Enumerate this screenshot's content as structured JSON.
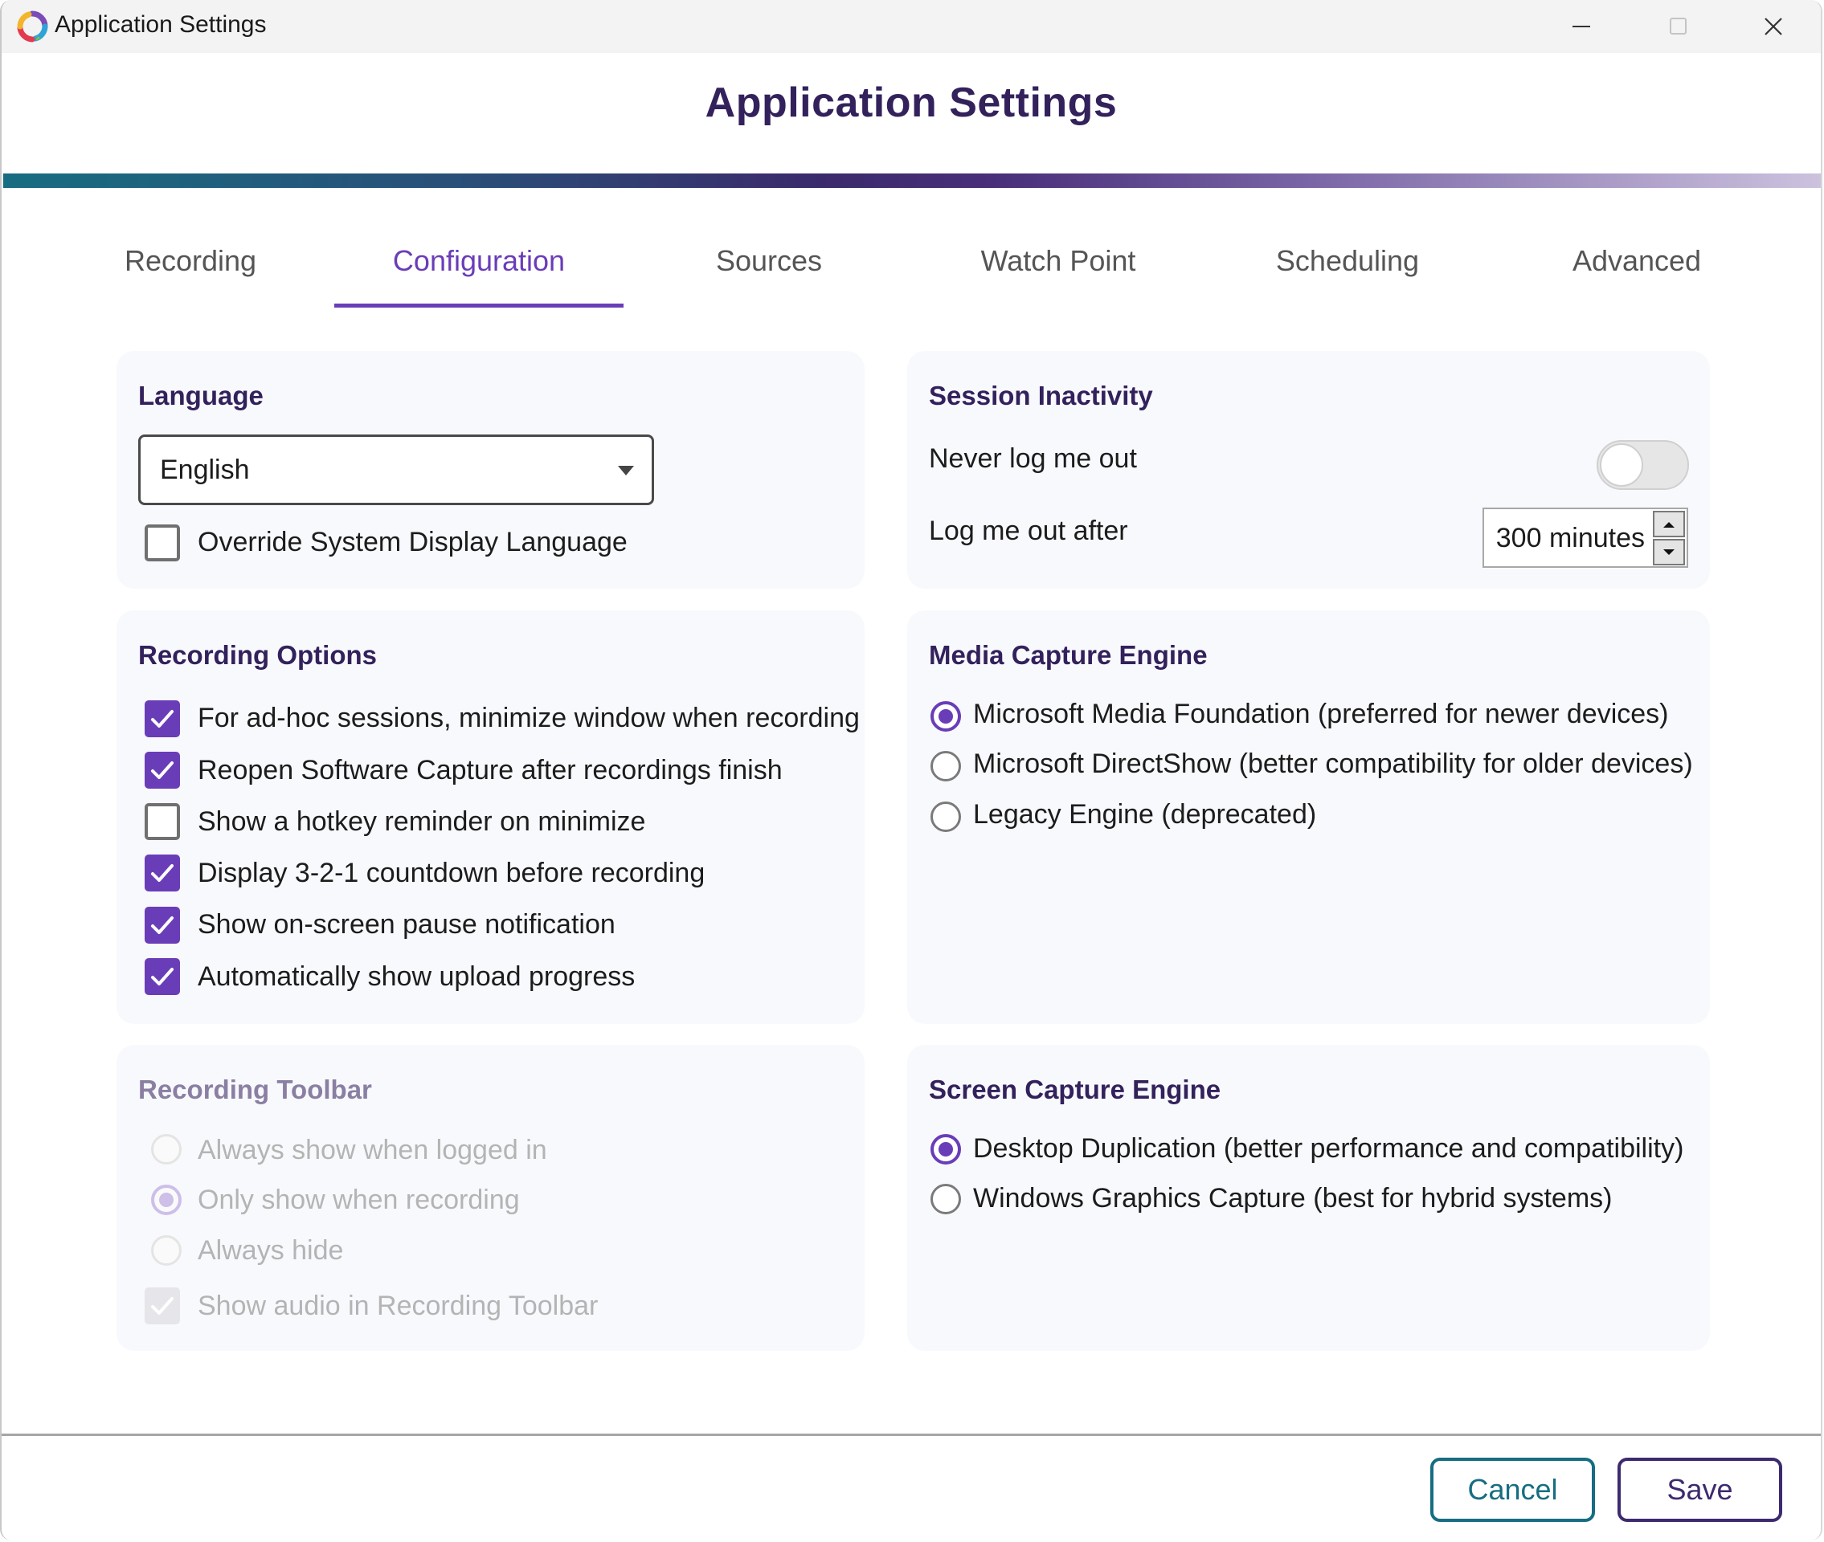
{
  "window": {
    "title": "Application Settings",
    "controls": {
      "minimize": "minimize",
      "maximize": "maximize",
      "close": "close"
    }
  },
  "header": {
    "title": "Application Settings"
  },
  "tabs": [
    {
      "label": "Recording",
      "active": false
    },
    {
      "label": "Configuration",
      "active": true
    },
    {
      "label": "Sources",
      "active": false
    },
    {
      "label": "Watch Point",
      "active": false
    },
    {
      "label": "Scheduling",
      "active": false
    },
    {
      "label": "Advanced",
      "active": false
    }
  ],
  "language": {
    "title": "Language",
    "selected": "English",
    "override": {
      "label": "Override System Display Language",
      "checked": false
    }
  },
  "session": {
    "title": "Session Inactivity",
    "never_logout": {
      "label": "Never log me out",
      "on": false
    },
    "logout_after": {
      "label": "Log me out after",
      "value": "300 minutes"
    }
  },
  "recording_options": {
    "title": "Recording Options",
    "items": [
      {
        "label": "For ad-hoc sessions, minimize window when recording",
        "checked": true
      },
      {
        "label": "Reopen Software Capture after recordings finish",
        "checked": true
      },
      {
        "label": "Show a hotkey reminder on minimize",
        "checked": false
      },
      {
        "label": "Display 3-2-1 countdown before recording",
        "checked": true
      },
      {
        "label": "Show on-screen pause notification",
        "checked": true
      },
      {
        "label": "Automatically show upload progress",
        "checked": true
      }
    ]
  },
  "media_engine": {
    "title": "Media Capture Engine",
    "options": [
      {
        "label": "Microsoft Media Foundation (preferred for newer devices)",
        "selected": true
      },
      {
        "label": "Microsoft DirectShow (better compatibility for older devices)",
        "selected": false
      },
      {
        "label": "Legacy Engine (deprecated)",
        "selected": false
      }
    ]
  },
  "recording_toolbar": {
    "title": "Recording Toolbar",
    "disabled": true,
    "options": [
      {
        "label": "Always show when logged in",
        "selected": false
      },
      {
        "label": "Only show when recording",
        "selected": true
      },
      {
        "label": "Always hide",
        "selected": false
      }
    ],
    "show_audio": {
      "label": "Show audio in Recording Toolbar",
      "checked": true
    }
  },
  "screen_engine": {
    "title": "Screen Capture Engine",
    "options": [
      {
        "label": "Desktop Duplication (better performance and compatibility)",
        "selected": true
      },
      {
        "label": "Windows Graphics Capture (best for hybrid systems)",
        "selected": false
      }
    ]
  },
  "footer": {
    "cancel_label": "Cancel",
    "save_label": "Save"
  },
  "colors": {
    "accent": "#6a3db8",
    "title": "#33215c",
    "cancel": "#176d81",
    "save": "#3d2a6e"
  }
}
